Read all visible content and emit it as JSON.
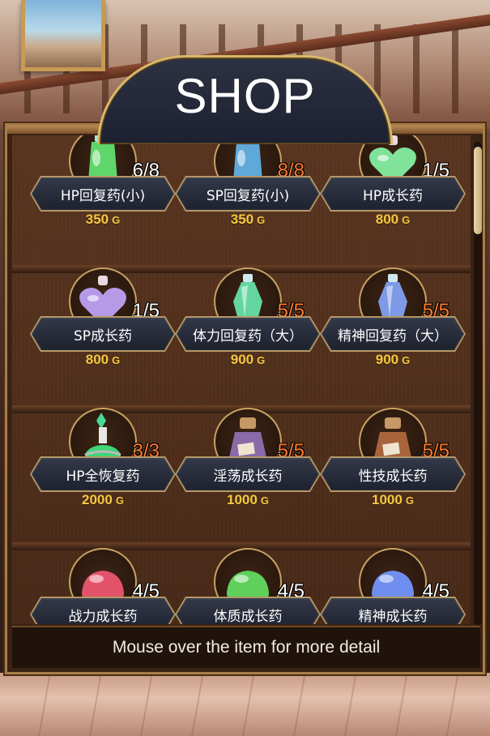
{
  "title": "SHOP",
  "info_text": "Mouse over the item for more detail",
  "currency": "G",
  "items": [
    {
      "name": "HP回复药(小)",
      "stock": "6/8",
      "price": "350",
      "sold_out": false,
      "icon": "green-potion-bottle-icon",
      "color": "#5fd66a"
    },
    {
      "name": "SP回复药(小)",
      "stock": "8/8",
      "price": "350",
      "sold_out": true,
      "icon": "blue-potion-bottle-icon",
      "color": "#5fa9d9"
    },
    {
      "name": "HP成长药",
      "stock": "1/5",
      "price": "800",
      "sold_out": false,
      "icon": "green-heart-flask-icon",
      "color": "#7fe39a"
    },
    {
      "name": "SP成长药",
      "stock": "1/5",
      "price": "800",
      "sold_out": false,
      "icon": "purple-heart-flask-icon",
      "color": "#b69ae8"
    },
    {
      "name": "体力回复药（大）",
      "stock": "5/5",
      "price": "900",
      "sold_out": true,
      "icon": "green-crystal-vial-icon",
      "color": "#63d6a0"
    },
    {
      "name": "精神回复药（大）",
      "stock": "5/5",
      "price": "900",
      "sold_out": true,
      "icon": "blue-crystal-vial-icon",
      "color": "#7e9ae6"
    },
    {
      "name": "HP全恢复药",
      "stock": "3/3",
      "price": "2000",
      "sold_out": true,
      "icon": "ornate-green-flask-icon",
      "color": "#3fd676"
    },
    {
      "name": "淫荡成长药",
      "stock": "5/5",
      "price": "1000",
      "sold_out": true,
      "icon": "purple-corked-jar-icon",
      "color": "#8a6aa8"
    },
    {
      "name": "性技成长药",
      "stock": "5/5",
      "price": "1000",
      "sold_out": true,
      "icon": "brown-corked-jar-icon",
      "color": "#a8653c"
    },
    {
      "name": "战力成长药",
      "stock": "4/5",
      "price": "",
      "sold_out": false,
      "icon": "red-slime-icon",
      "color": "#e2536a"
    },
    {
      "name": "体质成长药",
      "stock": "4/5",
      "price": "",
      "sold_out": false,
      "icon": "green-slime-icon",
      "color": "#5fd05a"
    },
    {
      "name": "精神成长药",
      "stock": "4/5",
      "price": "",
      "sold_out": false,
      "icon": "blue-slime-icon",
      "color": "#6f8ef0"
    }
  ]
}
